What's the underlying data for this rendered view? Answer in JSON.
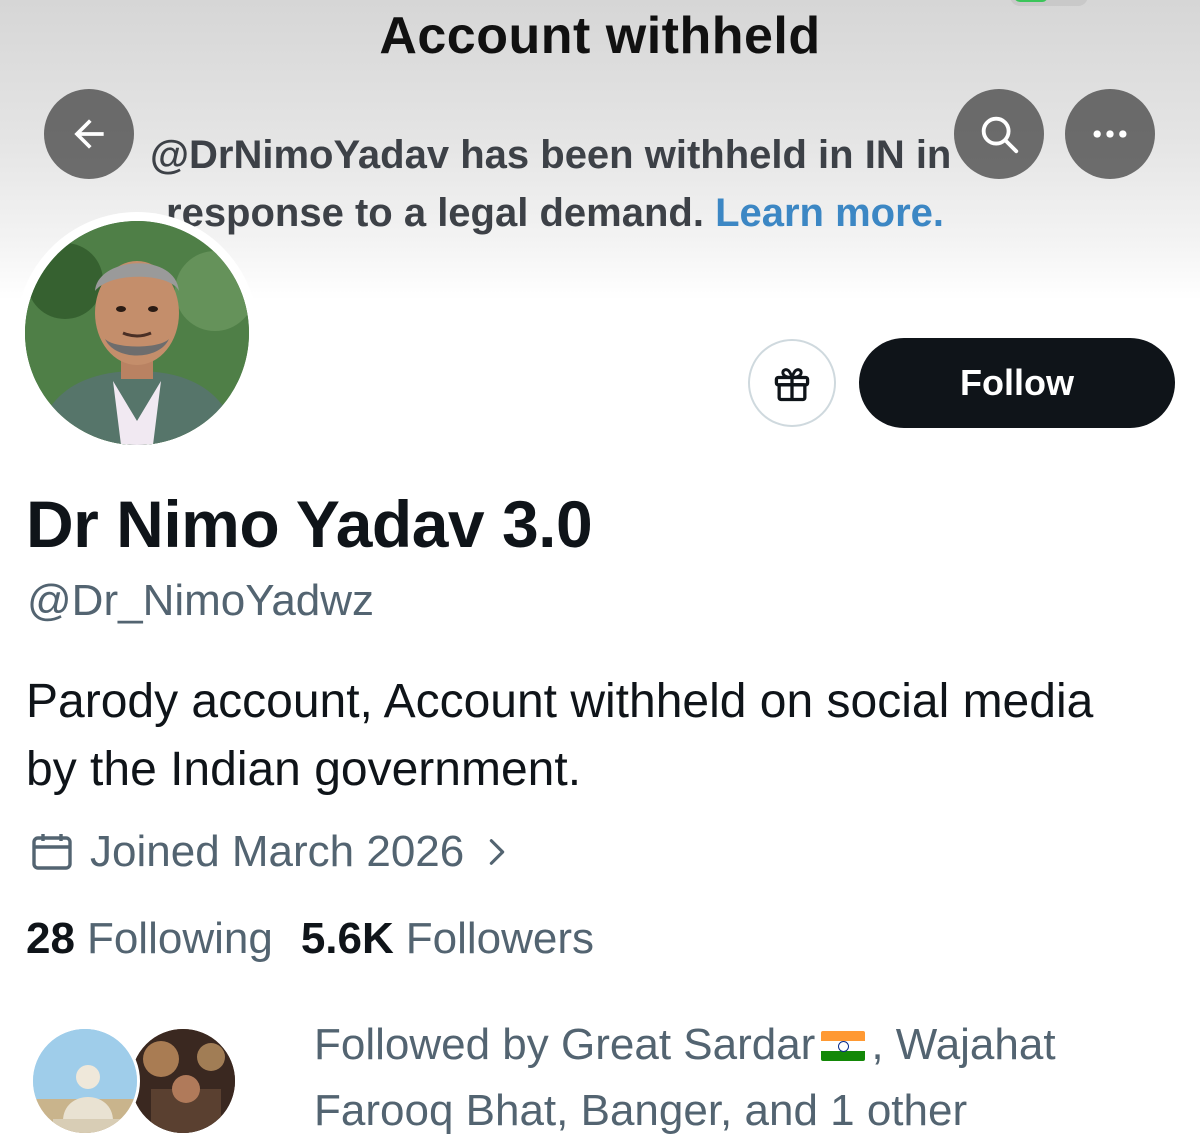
{
  "header": {
    "title": "Account withheld",
    "notice_text": "@DrNimoYadav has been withheld in IN in",
    "notice_text_2": "response to a legal demand.",
    "learn_more": "Learn more."
  },
  "icons": {
    "back": "arrow-left-icon",
    "search": "search-icon",
    "more": "more-horizontal-icon",
    "gift": "gift-icon",
    "calendar": "calendar-icon"
  },
  "profile": {
    "display_name": "Dr Nimo Yadav 3.0",
    "handle": "@Dr_NimoYadwz",
    "bio": "Parody account, Account withheld on social media by the Indian government.",
    "joined": "Joined March 2026",
    "follow_label": "Follow"
  },
  "stats": {
    "following_count": "28",
    "following_label": "Following",
    "followers_count": "5.6K",
    "followers_label": "Followers"
  },
  "followed_by": {
    "prefix": "Followed by Great Sardar",
    "suffix": ", Wajahat Farooq Bhat, Banger, and 1 other"
  },
  "colors": {
    "link": "#3c87c4",
    "follow_button": "#0f1419",
    "secondary_text": "#536471"
  }
}
